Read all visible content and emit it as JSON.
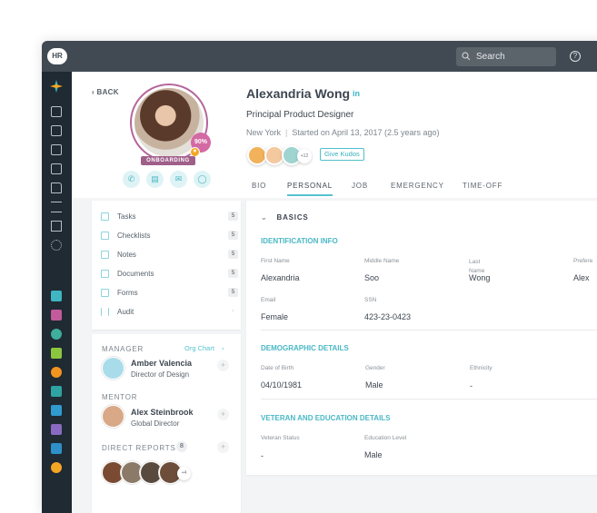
{
  "topbar": {
    "logo": "HR",
    "search_placeholder": "Search",
    "help_icon": "?"
  },
  "sidebar": {
    "icons": [
      "app-logo",
      "tasks",
      "inbox",
      "calendar",
      "contacts",
      "folder",
      "checklist",
      "notes",
      "settings"
    ],
    "apps": [
      "#3fb6c2",
      "#c35a9b",
      "#3fae9c",
      "#8cc63f",
      "#f2941f",
      "#2fa3a2",
      "#2f9bcf",
      "#8a6ac0",
      "#2e8fc9",
      "#f5a623"
    ]
  },
  "profile": {
    "back": "BACK",
    "name": "Alexandria Wong",
    "linkedin": "in",
    "title": "Principal Product Designer",
    "location": "New York",
    "separator": "|",
    "started": "Started on April 13, 2017 (2.5 years ago)",
    "completion": "90%",
    "status": "ONBOARDING",
    "kudos_more": "+12",
    "give_kudos": "Give Kudos",
    "action_button": "AC"
  },
  "tabs": [
    {
      "label": "BIO"
    },
    {
      "label": "PERSONAL",
      "active": true
    },
    {
      "label": "JOB"
    },
    {
      "label": "EMERGENCY"
    },
    {
      "label": "TIME-OFF"
    }
  ],
  "menu": [
    {
      "label": "Tasks",
      "count": "5"
    },
    {
      "label": "Checklists",
      "count": "5"
    },
    {
      "label": "Notes",
      "count": "5"
    },
    {
      "label": "Documents",
      "count": "5"
    },
    {
      "label": "Forms",
      "count": "5"
    },
    {
      "label": "Audit",
      "count": "›"
    }
  ],
  "people": {
    "manager_label": "MANAGER",
    "org_chart": "Org Chart",
    "manager_name": "Amber Valencia",
    "manager_role": "Director of Design",
    "mentor_label": "MENTOR",
    "mentor_name": "Alex Steinbrook",
    "mentor_role": "Global Director",
    "reports_label": "DIRECT REPORTS",
    "reports_count": "8",
    "reports_more": "+4"
  },
  "basics": {
    "title": "BASICS",
    "identification": {
      "heading": "IDENTIFICATION INFO",
      "first_label": "First Name",
      "first": "Alexandria",
      "middle_label": "Middle Name",
      "middle": "Soo",
      "last_label": "Last Name",
      "last": "Wong",
      "preferred_label": "Prefere",
      "preferred": "Alex",
      "email_label": "Email",
      "email": "Female",
      "ssn_label": "SSN",
      "ssn": "423-23-0423"
    },
    "demographic": {
      "heading": "DEMOGRAPHIC DETAILS",
      "dob_label": "Date of Birth",
      "dob": "04/10/1981",
      "gender_label": "Gender",
      "gender": "Male",
      "ethnicity_label": "Ethnicity",
      "ethnicity": "-"
    },
    "veteran": {
      "heading": "VETERAN AND EDUCATION DETAILS",
      "vet_label": "Veteran Status",
      "vet": "-",
      "edu_label": "Education Level",
      "edu": "Male"
    }
  },
  "colors": {
    "accent": "#56c3cf",
    "topbar": "#414a52",
    "sidebar": "#1f2a33",
    "onboarding": "#a05f8a"
  }
}
